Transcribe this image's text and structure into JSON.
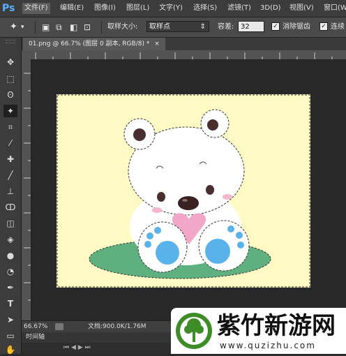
{
  "app": {
    "logo": "Ps"
  },
  "menu": [
    "文件(F)",
    "编辑(E)",
    "图像(I)",
    "图层(L)",
    "文字(Y)",
    "选择(S)",
    "滤镜(T)",
    "3D(D)",
    "视图(V)",
    "窗口(W)"
  ],
  "options": {
    "sample_size_label": "取样大小:",
    "sample_size_value": "取样点",
    "tolerance_label": "容差:",
    "tolerance_value": "32",
    "antialias_label": "消除锯齿",
    "contiguous_label": "连续"
  },
  "document": {
    "tab_title": "01.png @ 66.7% (图层 0 副本, RGB/8) *",
    "close": "×"
  },
  "status": {
    "zoom": "66.67%",
    "doc_info": "文档:900.0K/1.76M"
  },
  "timeline": {
    "label": "时间轴"
  },
  "watermark": {
    "name": "紫竹新游网",
    "url": "www.quzizhu.com"
  },
  "icons": {
    "move": "✥",
    "marquee": "⬚",
    "lasso": "ʘ",
    "magic_wand": "✦",
    "crop": "⌗",
    "eyedropper": "⁄",
    "healing": "✚",
    "brush": "╱",
    "stamp": "⊥",
    "history_brush": "ↀ",
    "eraser": "◫",
    "bucket": "◈",
    "blur": "●",
    "dodge": "◔",
    "pen": "✒",
    "type": "T",
    "path_select": "➤",
    "shape": "▭",
    "hand": "✋"
  },
  "colors": {
    "canvas_bg": "#fff9c4",
    "grass": "#5fb07f",
    "paw_blue": "#5ab2ea",
    "heart_pink": "#f2a7c8",
    "ps_blue": "#5ab0ff",
    "watermark_green": "#3d8c28"
  }
}
